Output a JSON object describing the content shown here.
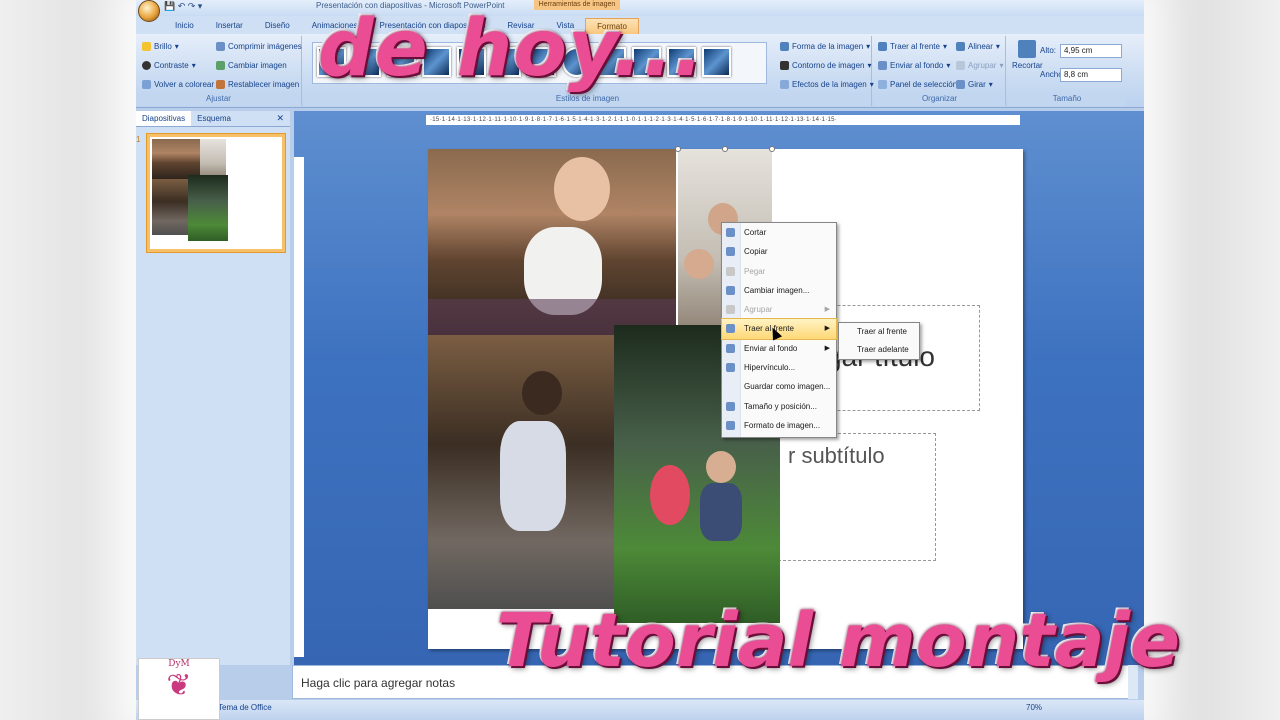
{
  "window": {
    "title": "Presentación con diapositivas - Microsoft PowerPoint",
    "context_label": "Herramientas de imagen"
  },
  "tabs": [
    "Inicio",
    "Insertar",
    "Diseño",
    "Animaciones",
    "Presentación con diapositivas",
    "Revisar",
    "Vista",
    "Formato"
  ],
  "ribbon": {
    "adjust": {
      "label": "Ajustar",
      "brillo": "Brillo",
      "contraste": "Contraste",
      "volver_colorear": "Volver a colorear",
      "comprimir": "Comprimir imágenes",
      "cambiar": "Cambiar imagen",
      "restablecer": "Restablecer imagen"
    },
    "styles": {
      "label": "Estilos de imagen",
      "forma": "Forma de la imagen",
      "contorno": "Contorno de imagen",
      "efectos": "Efectos de la imagen"
    },
    "organize": {
      "label": "Organizar",
      "traer_frente": "Traer al frente",
      "enviar_fondo": "Enviar al fondo",
      "panel_seleccion": "Panel de selección",
      "alinear": "Alinear",
      "agrupar": "Agrupar",
      "girar": "Girar"
    },
    "size": {
      "label": "Tamaño",
      "recortar": "Recortar",
      "alto_label": "Alto:",
      "alto_value": "4,95 cm",
      "ancho_label": "Ancho:",
      "ancho_value": "8,8 cm"
    }
  },
  "pane": {
    "tab_slides": "Diapositivas",
    "tab_outline": "Esquema",
    "slide_number": "1"
  },
  "ruler_h": "·15·1·14·1·13·1·12·1·11·1·10·1·9·1·8·1·7·1·6·1·5·1·4·1·3·1·2·1·1·1·0·1·1·1·2·1·3·1·4·1·5·1·6·1·7·1·8·1·9·1·10·1·11·1·12·1·13·1·14·1·15·",
  "slide": {
    "title_partial": "agregar título",
    "subtitle_partial": "r subtítulo"
  },
  "context_menu": {
    "items": [
      {
        "label": "Cortar",
        "disabled": false
      },
      {
        "label": "Copiar",
        "disabled": false
      },
      {
        "label": "Pegar",
        "disabled": true
      },
      {
        "label": "Cambiar imagen...",
        "disabled": false
      },
      {
        "label": "Agrupar",
        "disabled": true,
        "submenu": true
      },
      {
        "label": "Traer al frente",
        "disabled": false,
        "submenu": true,
        "hover": true
      },
      {
        "label": "Enviar al fondo",
        "disabled": false,
        "submenu": true
      },
      {
        "label": "Hipervínculo...",
        "disabled": false
      },
      {
        "label": "Guardar como imagen...",
        "disabled": false
      },
      {
        "label": "Tamaño y posición...",
        "disabled": false
      },
      {
        "label": "Formato de imagen...",
        "disabled": false
      }
    ],
    "submenu": [
      "Traer al frente",
      "Traer adelante"
    ]
  },
  "notes": "Haga clic para agregar notas",
  "status": {
    "theme": "Tema de Office",
    "zoom": "70%"
  },
  "logo_text": "DyM",
  "overlay": {
    "title": "de hoy...",
    "caption": "Tutorial montaje"
  },
  "colors": {
    "accent_pink": "#ea4d93",
    "ribbon_blue": "#cadcf2",
    "workspace_blue": "#3d72c0"
  }
}
